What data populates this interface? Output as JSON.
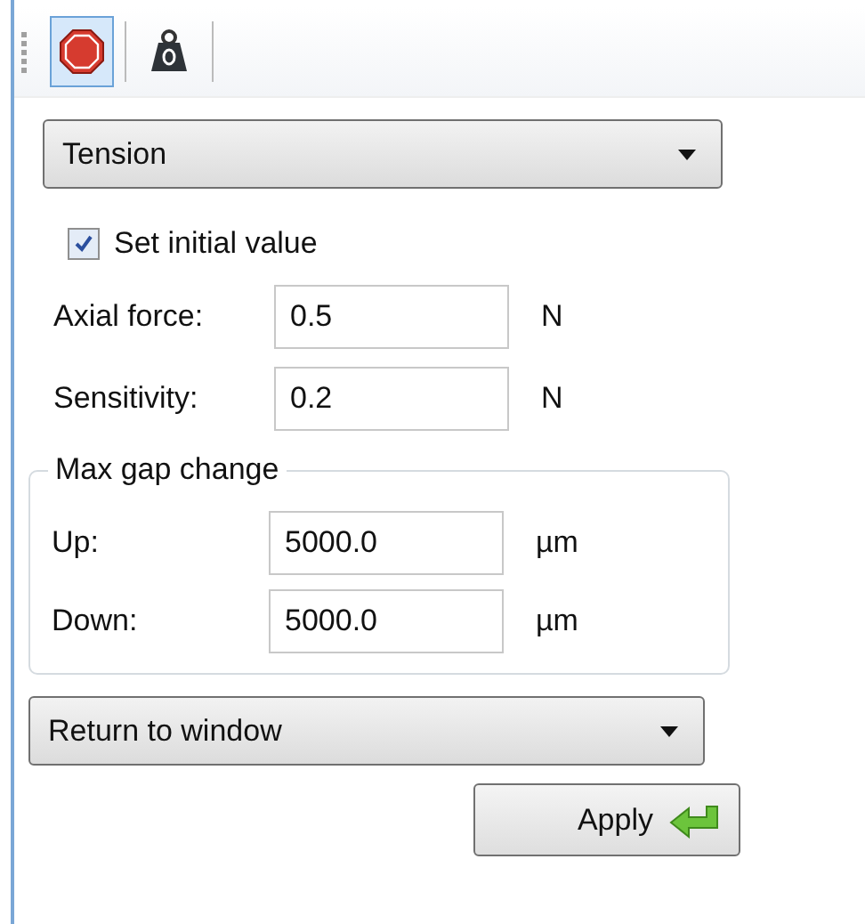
{
  "toolbar": [
    {
      "kind": "stop",
      "selected": true
    },
    {
      "kind": "weight",
      "selected": false
    }
  ],
  "mode_dropdown": {
    "value": "Tension"
  },
  "set_initial_value": {
    "label": "Set initial value",
    "checked": true
  },
  "fields": [
    {
      "label": "Axial force:",
      "value": "0.5",
      "unit": "N"
    },
    {
      "label": "Sensitivity:",
      "value": "0.2",
      "unit": "N"
    }
  ],
  "max_gap_change": {
    "title": "Max gap change",
    "fields": [
      {
        "label": "Up:",
        "value": "5000.0",
        "unit": "µm"
      },
      {
        "label": "Down:",
        "value": "5000.0",
        "unit": "µm"
      }
    ]
  },
  "return_dropdown": {
    "value": "Return to window"
  },
  "apply_button": {
    "label": "Apply"
  }
}
